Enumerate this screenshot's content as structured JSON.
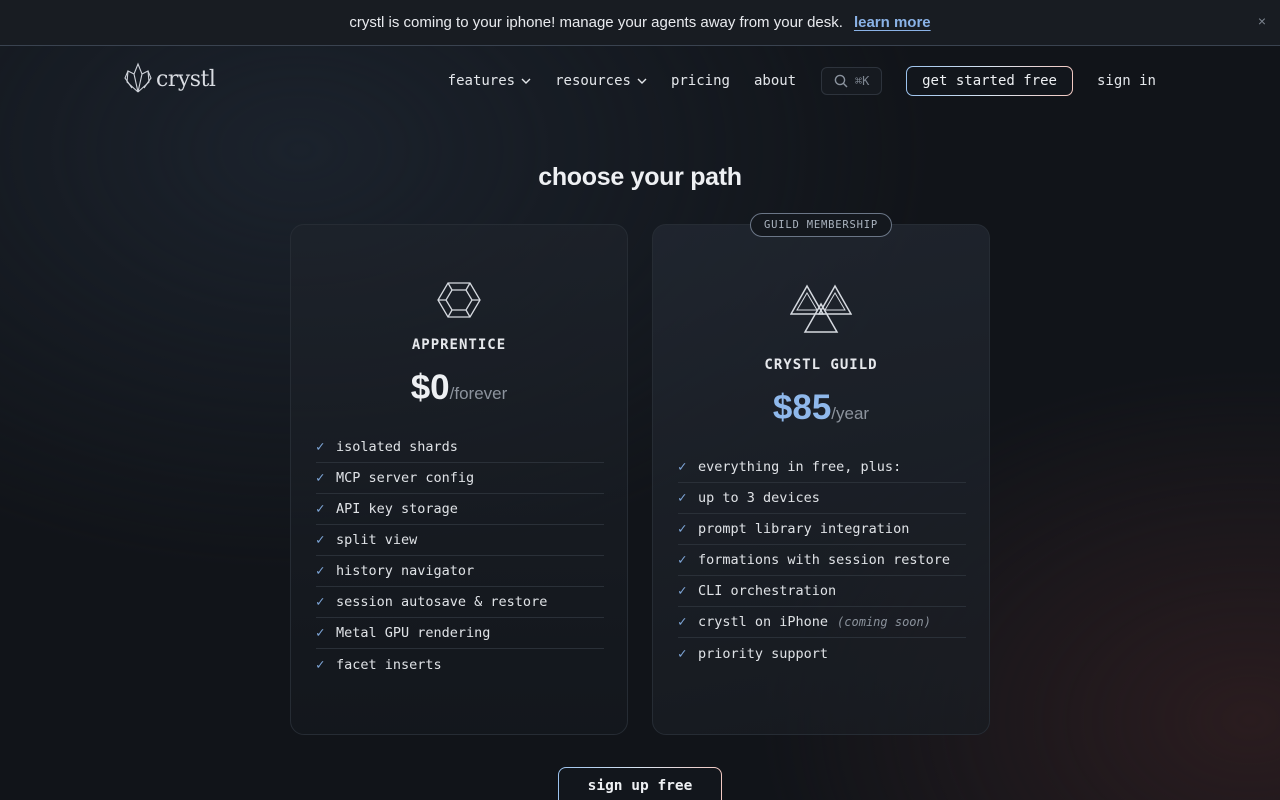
{
  "announcement": {
    "message": "crystl is coming to your iphone! manage your agents away from your desk.",
    "link_label": "learn more",
    "close_glyph": "×"
  },
  "brand": {
    "name": "crystl",
    "icon": "crystal-logo-icon"
  },
  "nav": {
    "features_label": "features",
    "resources_label": "resources",
    "pricing_label": "pricing",
    "about_label": "about",
    "search_shortcut": "⌘K",
    "search_icon": "search-icon",
    "cta_label": "get started free",
    "signin_label": "sign in"
  },
  "page": {
    "headline": "choose your path"
  },
  "plans": [
    {
      "tier": "APPRENTICE",
      "icon": "hexagon-crystal-icon",
      "price": "$0",
      "period": "/forever",
      "features": [
        {
          "text": "isolated shards"
        },
        {
          "text": "MCP server config"
        },
        {
          "text": "API key storage"
        },
        {
          "text": "split view"
        },
        {
          "text": "history navigator"
        },
        {
          "text": "session autosave & restore"
        },
        {
          "text": "Metal GPU rendering"
        },
        {
          "text": "facet inserts"
        }
      ]
    },
    {
      "badge": "GUILD MEMBERSHIP",
      "tier": "CRYSTL GUILD",
      "icon": "triple-triangle-icon",
      "price": "$85",
      "period": "/year",
      "features": [
        {
          "text": "everything in free, plus:"
        },
        {
          "text": "up to 3 devices"
        },
        {
          "text": "prompt library integration"
        },
        {
          "text": "formations with session restore"
        },
        {
          "text": "CLI orchestration"
        },
        {
          "text": "crystl on iPhone",
          "note": "(coming soon)"
        },
        {
          "text": "priority support"
        }
      ]
    }
  ],
  "check_glyph": "✓",
  "signup_label": "sign up free",
  "colors": {
    "accent_blue": "#8fb8eb",
    "background": "#111419",
    "border": "#262c34"
  }
}
